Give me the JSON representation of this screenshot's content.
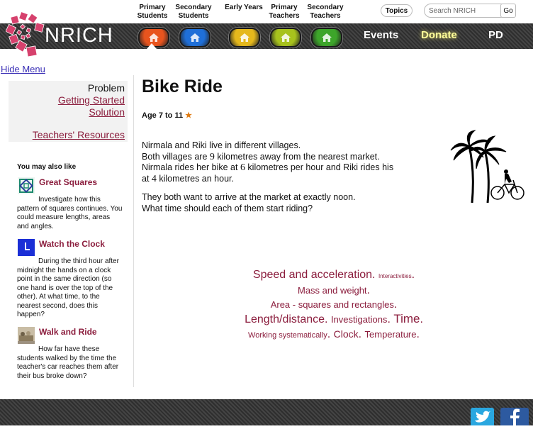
{
  "topnav": {
    "links": [
      {
        "line1": "Primary",
        "line2": "Students"
      },
      {
        "line1": "Secondary",
        "line2": "Students"
      },
      {
        "line1": "Early Years",
        "line2": ""
      },
      {
        "line1": "Primary",
        "line2": "Teachers"
      },
      {
        "line1": "Secondary",
        "line2": "Teachers"
      }
    ],
    "topics_label": "Topics",
    "search_placeholder": "Search NRICH",
    "go_label": "Go"
  },
  "band": {
    "logo_text": "NRICH",
    "home_buttons": [
      {
        "color": "#e8541e"
      },
      {
        "color": "#1f6fd8"
      },
      {
        "color": "#e5b81c"
      },
      {
        "color": "#a7c21d"
      },
      {
        "color": "#3da52a"
      }
    ],
    "links": {
      "events": "Events",
      "donate": "Donate",
      "pd": "PD"
    }
  },
  "hide_menu": "Hide Menu",
  "sidebar": {
    "current": "Problem",
    "links": [
      "Getting Started",
      "Solution",
      "Teachers' Resources"
    ],
    "also_title": "You may also like",
    "also": [
      {
        "title": "Great Squares",
        "desc": "Investigate how this pattern of squares continues. You could measure lengths, areas and angles.",
        "icon": "squares-icon"
      },
      {
        "title": "Watch the Clock",
        "desc": "During the third hour after midnight the hands on a clock point in the same direction (so one hand is over the top of the other). At what time, to the nearest second, does this happen?",
        "icon": "clock-icon"
      },
      {
        "title": "Walk and Ride",
        "desc": "How far have these students walked by the time the teacher's car reaches them after their bus broke down?",
        "icon": "bus-photo-icon"
      }
    ]
  },
  "main": {
    "title": "Bike Ride",
    "age": "Age 7 to 11",
    "p1": {
      "a": "Nirmala and Riki live in different villages.",
      "b1": "Both villages are ",
      "n1": "9",
      "b2": " kilometres away from the nearest market.",
      "c1": "Nirmala rides her bike at ",
      "n2": "6",
      "c2": " kilometres per hour and Riki rides his",
      "d1": "at ",
      "n3": "4",
      "d2": " kilometres an hour."
    },
    "p2": {
      "a": "They both want to arrive at the market at exactly noon.",
      "b": "What time should each of them start riding?"
    }
  },
  "tags": [
    [
      "Speed and acceleration",
      "Interactivities"
    ],
    [
      "Mass and weight"
    ],
    [
      "Area - squares and rectangles"
    ],
    [
      "Length/distance",
      "Investigations",
      "Time"
    ],
    [
      "Working systematically",
      "Clock",
      "Temperature"
    ]
  ],
  "footer": {
    "twitter_icon": "twitter-icon",
    "facebook_icon": "facebook-icon"
  }
}
